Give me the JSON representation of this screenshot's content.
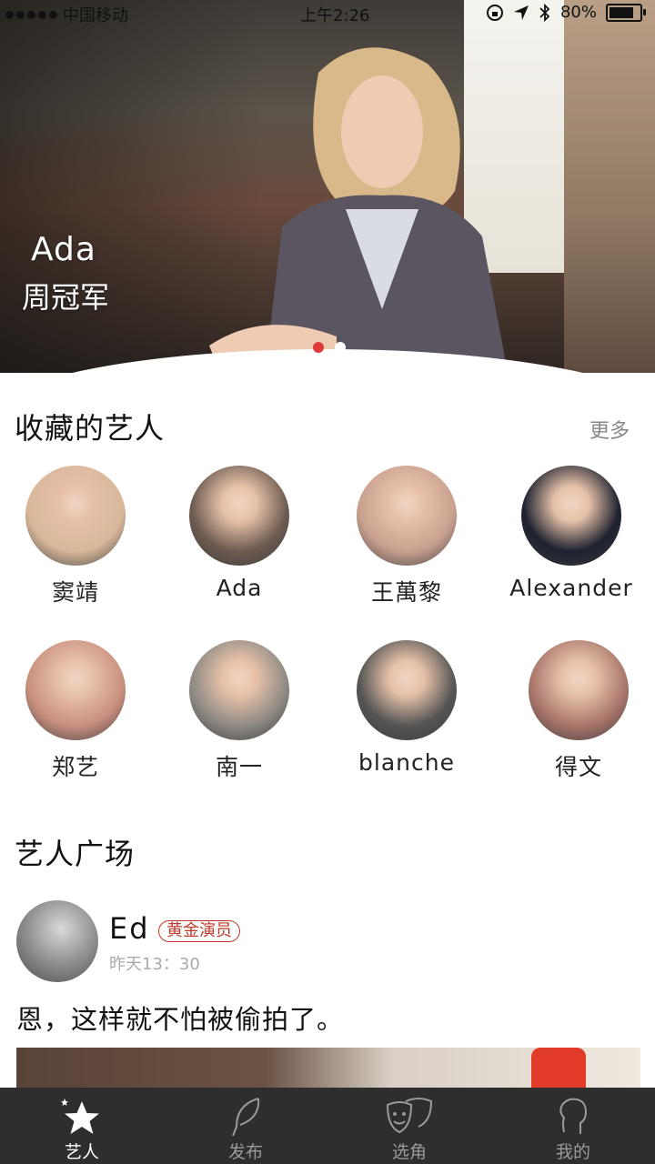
{
  "status_bar": {
    "carrier": "中国移动",
    "time": "上午2:26",
    "battery": "80%",
    "battery_level": 0.8
  },
  "hero": {
    "name": "Ada",
    "title": "周冠军",
    "slide_count": 2,
    "active_slide": 1
  },
  "favorites": {
    "title": "收藏的艺人",
    "more_label": "更多",
    "artists": [
      {
        "name": "窦靖",
        "color": "#d8b79a"
      },
      {
        "name": "Ada",
        "color": "#6d5b50"
      },
      {
        "name": "王萬黎",
        "color": "#c9a08f"
      },
      {
        "name": "Alexander",
        "color": "#1e2230"
      },
      {
        "name": "郑艺",
        "color": "#c98f7f"
      },
      {
        "name": "南一",
        "color": "#8e8a84"
      },
      {
        "name": "blanche",
        "color": "#555555"
      },
      {
        "name": "得文",
        "color": "#a8756a"
      }
    ]
  },
  "plaza": {
    "title": "艺人广场",
    "post": {
      "author": "Ed",
      "badge": "黄金演员",
      "time": "昨天13：30",
      "text": "恩，这样就不怕被偷拍了。"
    }
  },
  "tabbar": {
    "tabs": [
      {
        "label": "艺人",
        "icon": "star-icon",
        "active": true
      },
      {
        "label": "发布",
        "icon": "feather-icon",
        "active": false
      },
      {
        "label": "选角",
        "icon": "theater-masks-icon",
        "active": false
      },
      {
        "label": "我的",
        "icon": "profile-icon",
        "active": false
      }
    ]
  },
  "colors": {
    "accent_red": "#e03a3a",
    "badge_red": "#c0392b",
    "tabbar_bg": "#2e2e2e"
  }
}
